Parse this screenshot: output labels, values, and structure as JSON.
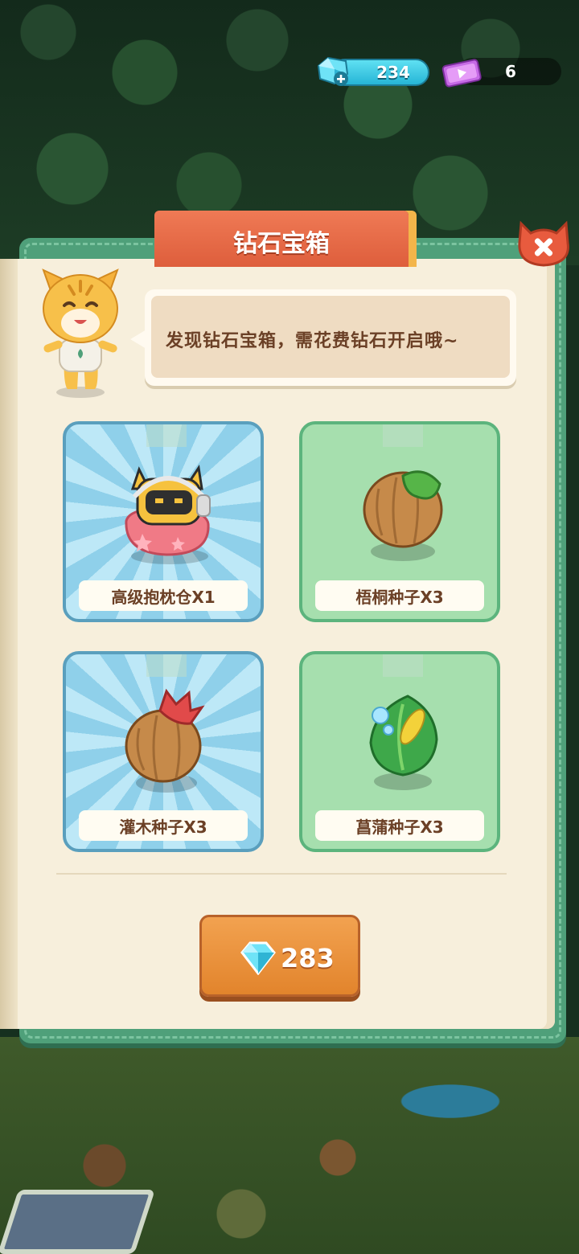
{
  "hud": {
    "gems_value": "234",
    "tickets_value": "6"
  },
  "panel": {
    "title": "钻石宝箱",
    "message": "发现钻石宝箱，需花费钻石开启哦~",
    "rewards": [
      {
        "label": "高级抱枕仓X1",
        "icon": "pillow-pod-icon",
        "card_color": "#bde8f7"
      },
      {
        "label": "梧桐种子X3",
        "icon": "wutong-seed-icon",
        "card_color": "#a6dfae"
      },
      {
        "label": "灌木种子X3",
        "icon": "shrub-seed-icon",
        "card_color": "#bde8f7"
      },
      {
        "label": "菖蒲种子X3",
        "icon": "calamus-seed-icon",
        "card_color": "#a6dfae"
      }
    ],
    "cost_value": "283"
  },
  "colors": {
    "frame": "#4fa07a",
    "title_tab": "#de5e3c",
    "button": "#e2842c",
    "gem": "#5fd6f0"
  }
}
